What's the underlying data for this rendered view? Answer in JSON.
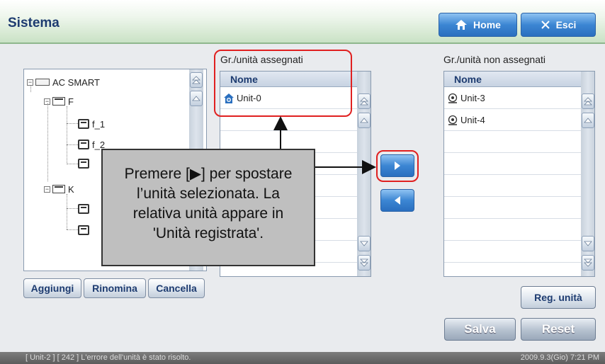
{
  "header": {
    "title": "Sistema",
    "home_label": "Home",
    "exit_label": "Esci"
  },
  "tree": {
    "root": "AC SMART",
    "groups": [
      {
        "label": "F",
        "units": [
          "f_1",
          "f_2",
          ""
        ]
      },
      {
        "label": "K",
        "units": [
          "",
          ""
        ]
      }
    ]
  },
  "tree_buttons": {
    "add": "Aggiungi",
    "rename": "Rinomina",
    "delete": "Cancella"
  },
  "assigned": {
    "title": "Gr./unità assegnati",
    "column": "Nome",
    "rows": [
      "Unit-0"
    ]
  },
  "unassigned": {
    "title": "Gr./unità non assegnati",
    "column": "Nome",
    "rows": [
      "Unit-3",
      "Unit-4"
    ]
  },
  "buttons": {
    "reg_unit": "Reg. unità",
    "save": "Salva",
    "reset": "Reset"
  },
  "callout": {
    "line1": "Premere [▶] per spostare",
    "line2": "l’unità selezionata. La",
    "line3": "relativa unità appare in",
    "line4": "'Unità registrata'."
  },
  "status": {
    "message": "[ Unit-2 ] [ 242 ] L'errore dell'unità è stato risolto.",
    "datetime": "2009.9.3(Gio)  7:21 PM"
  },
  "colors": {
    "highlight": "#e02020",
    "title_text": "#1d3b70",
    "header_green": "#c9e2c5",
    "button_blue": "#3c86d3"
  }
}
